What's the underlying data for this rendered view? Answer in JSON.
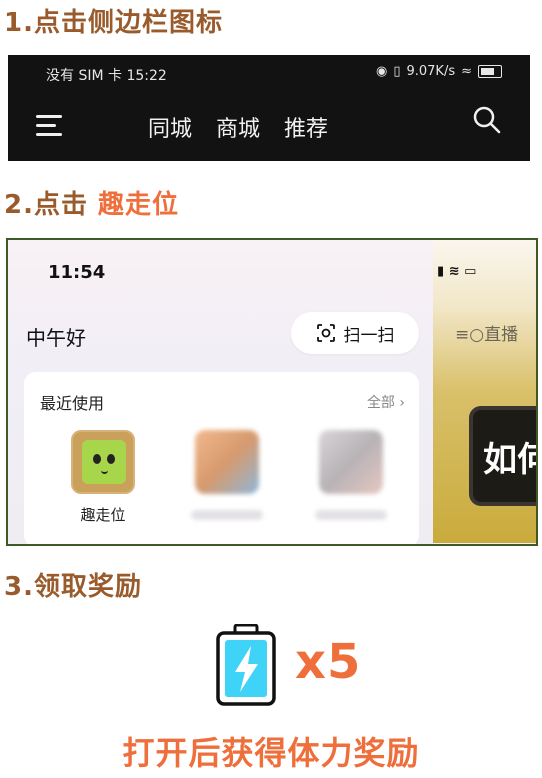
{
  "steps": [
    {
      "title": "1.点击侧边栏图标"
    },
    {
      "title_prefix": "2.点击 ",
      "title_accent": "趣走位"
    },
    {
      "title": "3.领取奖励"
    }
  ],
  "screenshot1": {
    "status_left": "没有 SIM 卡 15:22",
    "status_speed": "9.07K/s",
    "tabs": [
      "同城",
      "商城",
      "推荐"
    ],
    "icons": [
      "menu-icon",
      "search-icon",
      "battery-icon"
    ]
  },
  "screenshot2": {
    "time": "11:54",
    "greeting": "中午好",
    "scan_label": "扫一扫",
    "card_title": "最近使用",
    "card_all": "全部",
    "app_label": "趣走位",
    "side_live": "直播",
    "side_book_text": "如何",
    "icons": [
      "scan-icon",
      "chevron-right-icon",
      "signal-icon",
      "wifi-icon",
      "battery-icon"
    ]
  },
  "reward": {
    "multiplier": "x5",
    "cta": "打开后获得体力奖励",
    "colors": {
      "accent": "#ee6f3b",
      "brown": "#9a5b2c",
      "battery_fill": "#3fd3f7"
    }
  }
}
